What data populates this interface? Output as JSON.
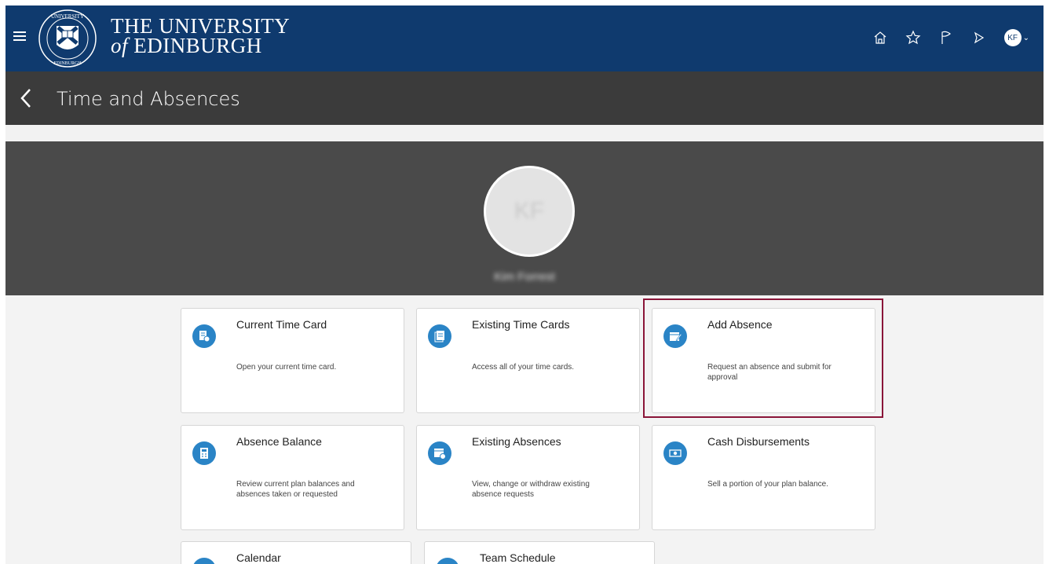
{
  "header": {
    "university_line1": "THE UNIVERSITY",
    "university_line2_of": "of",
    "university_line2_name": "EDINBURGH",
    "avatar_initials": "KF"
  },
  "page": {
    "title": "Time and Absences"
  },
  "profile": {
    "initials": "KF",
    "name": "Kim Forrest"
  },
  "tiles": [
    {
      "title": "Current Time Card",
      "desc": "Open your current time card.",
      "icon": "time-card-icon"
    },
    {
      "title": "Existing Time Cards",
      "desc": "Access all of your time cards.",
      "icon": "documents-icon"
    },
    {
      "title": "Add Absence",
      "desc": "Request an absence and submit for approval",
      "icon": "calendar-edit-icon"
    },
    {
      "title": "Absence Balance",
      "desc": "Review current plan balances and absences taken or requested",
      "icon": "calculator-icon"
    },
    {
      "title": "Existing Absences",
      "desc": "View, change or withdraw existing absence requests",
      "icon": "calendar-clock-icon"
    },
    {
      "title": "Cash Disbursements",
      "desc": "Sell a portion of your plan balance.",
      "icon": "cash-icon"
    },
    {
      "title": "Calendar",
      "desc": "",
      "icon": "calendar-icon"
    },
    {
      "title": "Team Schedule",
      "desc": "",
      "icon": "schedule-icon"
    }
  ],
  "colors": {
    "header": "#0f3a6e",
    "titlebar": "#3b3b3b",
    "banner": "#4a4a4a",
    "tile_icon": "#2a84c6",
    "highlight": "#8a1538"
  }
}
